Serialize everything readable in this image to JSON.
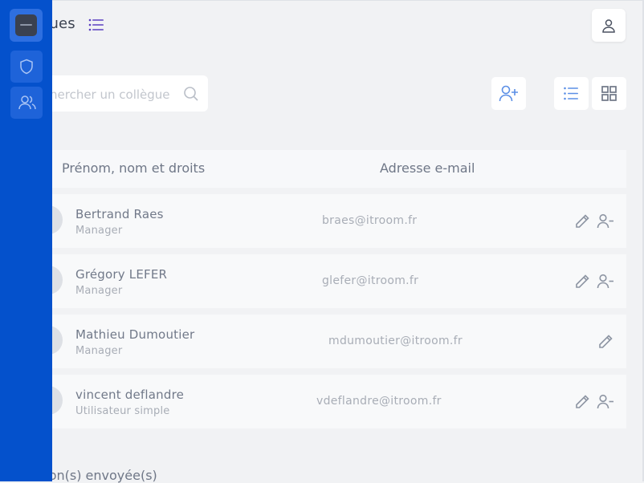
{
  "header": {
    "title": "gues"
  },
  "toolbar": {
    "search_placeholder": "hercher un collègue"
  },
  "table": {
    "columns": [
      "Prénom, nom et droits",
      "Adresse e-mail"
    ],
    "rows": [
      {
        "name": "Bertrand Raes",
        "role": "Manager",
        "email": "braes@itroom.fr",
        "removable": true
      },
      {
        "name": "Grégory LEFER",
        "role": "Manager",
        "email": "glefer@itroom.fr",
        "removable": true
      },
      {
        "name": "Mathieu Dumoutier",
        "role": "Manager",
        "email": "mdumoutier@itroom.fr",
        "removable": false
      },
      {
        "name": "vincent deflandre",
        "role": "Utilisateur simple",
        "email": "vdeflandre@itroom.fr",
        "removable": true
      }
    ]
  },
  "invitations": {
    "title": "tion(s) envoyée(s)"
  },
  "sidebar": {
    "items": [
      "logo",
      "shield-icon",
      "users-icon"
    ]
  },
  "colors": {
    "sidebar": "#0451cc",
    "accent": "#5b8fe6",
    "background": "#f1f2f4"
  }
}
